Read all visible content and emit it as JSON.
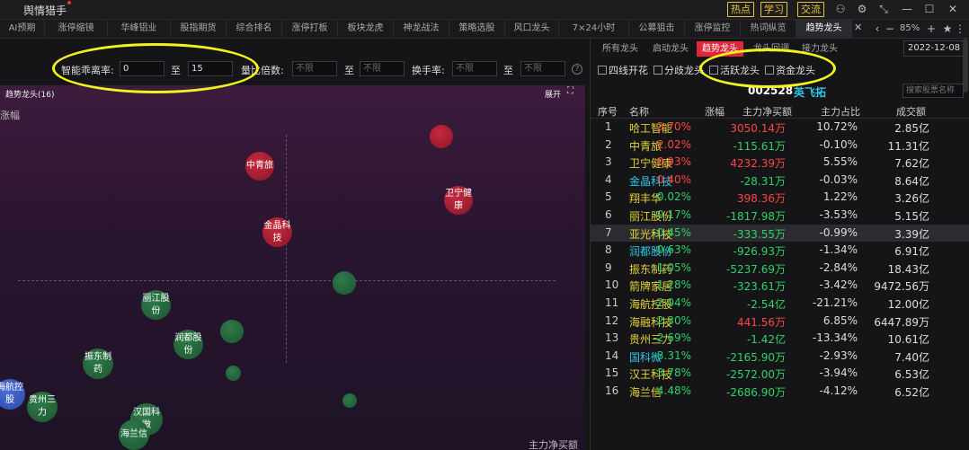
{
  "titlebar": {
    "title": "舆情猎手",
    "buttons": [
      "热点",
      "学习",
      "交流"
    ],
    "zoom": "85%"
  },
  "tabs": [
    "AI预期",
    "涨停缩镜",
    "华峰铝业",
    "股指期货",
    "综合排名",
    "涨停打板",
    "板块龙虎",
    "神龙战法",
    "策略选股",
    "风口龙头",
    "7×24小时",
    "公募狙击",
    "涨停监控",
    "热词纵览",
    "趋势龙头"
  ],
  "active_tab": "趋势龙头",
  "filter": {
    "label1": "智能乖离率:",
    "val1_from": "0",
    "to1": "至",
    "val1_to": "15",
    "label2": "量比倍数:",
    "ph_unlimited": "不限",
    "to2": "至",
    "label3": "换手率:",
    "to3": "至"
  },
  "bubble_panel": {
    "title": "趋势龙头(16)",
    "expand": "展开",
    "y_label": "涨幅",
    "x_label": "主力净买额",
    "bubbles": [
      {
        "label": "",
        "color": "red",
        "chg": 3.7
      },
      {
        "label": "中青旅",
        "color": "red",
        "chg": 2.02
      },
      {
        "label": "卫宁健康",
        "color": "red",
        "chg": 0.93
      },
      {
        "label": "金晶科技",
        "color": "red",
        "chg": 0.4
      },
      {
        "label": "",
        "color": "green",
        "chg": -0.45
      },
      {
        "label": "丽江股份",
        "color": "green",
        "chg": -0.17
      },
      {
        "label": "",
        "color": "green",
        "chg": -2.3
      },
      {
        "label": "润都股份",
        "color": "green",
        "chg": -0.63
      },
      {
        "label": "振东制药",
        "color": "green",
        "chg": -1.05
      },
      {
        "label": "",
        "color": "green",
        "chg": -1.28
      },
      {
        "label": "",
        "color": "green",
        "chg": -2.69
      },
      {
        "label": "海航控股",
        "color": "blue",
        "chg": -2.04
      },
      {
        "label": "贵州三力",
        "color": "green",
        "chg": -2.69
      },
      {
        "label": "汉国科微",
        "color": "green",
        "chg": -3.31
      },
      {
        "label": "海兰信",
        "color": "green",
        "chg": -4.48
      }
    ]
  },
  "right_panel": {
    "tabs": [
      "所有龙头",
      "启动龙头",
      "趋势龙头",
      "龙头回调",
      "接力龙头"
    ],
    "active_tab": "趋势龙头",
    "date": "2022-12-08",
    "checkboxes": [
      "四线开花",
      "分歧龙头",
      "活跃龙头",
      "资金龙头"
    ],
    "selected_code": "002528",
    "selected_name": "英飞拓",
    "search_placeholder": "搜索股票名称",
    "columns": [
      "序号",
      "名称",
      "涨幅",
      "主力净买额",
      "主力占比",
      "成交额"
    ],
    "rows": [
      {
        "idx": "1",
        "name": "哈工智能",
        "chg": "3.70%",
        "net": "3050.14万",
        "ratio": "10.72%",
        "vol": "2.85亿",
        "name_color": "yellow",
        "chg_dir": "up",
        "net_dir": "up"
      },
      {
        "idx": "2",
        "name": "中青旅",
        "chg": "2.02%",
        "net": "-115.61万",
        "ratio": "-0.10%",
        "vol": "11.31亿",
        "name_color": "yellow",
        "chg_dir": "up",
        "net_dir": "down"
      },
      {
        "idx": "3",
        "name": "卫宁健康",
        "chg": "0.93%",
        "net": "4232.39万",
        "ratio": "5.55%",
        "vol": "7.62亿",
        "name_color": "yellow",
        "chg_dir": "up",
        "net_dir": "up"
      },
      {
        "idx": "4",
        "name": "金晶科技",
        "chg": "0.40%",
        "net": "-28.31万",
        "ratio": "-0.03%",
        "vol": "8.64亿",
        "name_color": "cyan",
        "chg_dir": "up",
        "net_dir": "down"
      },
      {
        "idx": "5",
        "name": "翔丰华",
        "chg": "-0.02%",
        "net": "398.36万",
        "ratio": "1.22%",
        "vol": "3.26亿",
        "name_color": "yellow",
        "chg_dir": "down",
        "net_dir": "up"
      },
      {
        "idx": "6",
        "name": "丽江股份",
        "chg": "-0.17%",
        "net": "-1817.98万",
        "ratio": "-3.53%",
        "vol": "5.15亿",
        "name_color": "yellow",
        "chg_dir": "down",
        "net_dir": "down"
      },
      {
        "idx": "7",
        "name": "亚光科技",
        "chg": "-0.45%",
        "net": "-333.55万",
        "ratio": "-0.99%",
        "vol": "3.39亿",
        "name_color": "yellow",
        "chg_dir": "down",
        "net_dir": "down",
        "selected": true
      },
      {
        "idx": "8",
        "name": "润都股份",
        "chg": "-0.63%",
        "net": "-926.93万",
        "ratio": "-1.34%",
        "vol": "6.91亿",
        "name_color": "cyan",
        "chg_dir": "down",
        "net_dir": "down"
      },
      {
        "idx": "9",
        "name": "振东制药",
        "chg": "-1.05%",
        "net": "-5237.69万",
        "ratio": "-2.84%",
        "vol": "18.43亿",
        "name_color": "yellow",
        "chg_dir": "down",
        "net_dir": "down"
      },
      {
        "idx": "10",
        "name": "箭牌家居",
        "chg": "-1.28%",
        "net": "-323.61万",
        "ratio": "-3.42%",
        "vol": "9472.56万",
        "name_color": "yellow",
        "chg_dir": "down",
        "net_dir": "down"
      },
      {
        "idx": "11",
        "name": "海航控股",
        "chg": "-2.04%",
        "net": "-2.54亿",
        "ratio": "-21.21%",
        "vol": "12.00亿",
        "name_color": "yellow",
        "chg_dir": "down",
        "net_dir": "down"
      },
      {
        "idx": "12",
        "name": "海融科技",
        "chg": "-2.30%",
        "net": "441.56万",
        "ratio": "6.85%",
        "vol": "6447.89万",
        "name_color": "yellow",
        "chg_dir": "down",
        "net_dir": "up"
      },
      {
        "idx": "13",
        "name": "贵州三力",
        "chg": "-2.69%",
        "net": "-1.42亿",
        "ratio": "-13.34%",
        "vol": "10.61亿",
        "name_color": "yellow",
        "chg_dir": "down",
        "net_dir": "down"
      },
      {
        "idx": "14",
        "name": "国科微",
        "chg": "-3.31%",
        "net": "-2165.90万",
        "ratio": "-2.93%",
        "vol": "7.40亿",
        "name_color": "cyan",
        "chg_dir": "down",
        "net_dir": "down"
      },
      {
        "idx": "15",
        "name": "汉王科技",
        "chg": "-3.78%",
        "net": "-2572.00万",
        "ratio": "-3.94%",
        "vol": "6.53亿",
        "name_color": "yellow",
        "chg_dir": "down",
        "net_dir": "down"
      },
      {
        "idx": "16",
        "name": "海兰信",
        "chg": "-4.48%",
        "net": "-2686.90万",
        "ratio": "-4.12%",
        "vol": "6.52亿",
        "name_color": "yellow",
        "chg_dir": "down",
        "net_dir": "down"
      }
    ]
  }
}
